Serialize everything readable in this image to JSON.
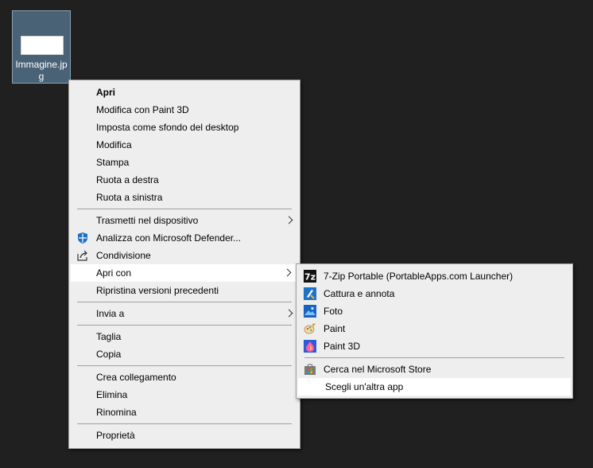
{
  "desktop": {
    "file_label": "Immagine.jpg"
  },
  "context_menu": {
    "items": [
      {
        "label": "Apri",
        "bold": true
      },
      {
        "label": "Modifica con Paint 3D"
      },
      {
        "label": "Imposta come sfondo del desktop"
      },
      {
        "label": "Modifica"
      },
      {
        "label": "Stampa"
      },
      {
        "label": "Ruota a destra"
      },
      {
        "label": "Ruota a sinistra"
      },
      {
        "label": "Trasmetti nel dispositivo",
        "submenu": true
      },
      {
        "label": "Analizza con Microsoft Defender...",
        "icon": "defender-shield-icon"
      },
      {
        "label": "Condivisione",
        "icon": "share-icon"
      },
      {
        "label": "Apri con",
        "submenu": true
      },
      {
        "label": "Ripristina versioni precedenti"
      },
      {
        "label": "Invia a",
        "submenu": true
      },
      {
        "label": "Taglia"
      },
      {
        "label": "Copia"
      },
      {
        "label": "Crea collegamento"
      },
      {
        "label": "Elimina"
      },
      {
        "label": "Rinomina"
      },
      {
        "label": "Proprietà"
      }
    ]
  },
  "open_with_submenu": {
    "items": [
      {
        "label": "7-Zip Portable (PortableApps.com Launcher)",
        "icon": "7zip-icon"
      },
      {
        "label": "Cattura e annota",
        "icon": "snip-sketch-icon"
      },
      {
        "label": "Foto",
        "icon": "photos-icon"
      },
      {
        "label": "Paint",
        "icon": "paint-icon"
      },
      {
        "label": "Paint 3D",
        "icon": "paint3d-icon"
      },
      {
        "label": "Cerca nel Microsoft Store",
        "icon": "store-icon"
      },
      {
        "label": "Scegli un'altra app"
      }
    ]
  }
}
